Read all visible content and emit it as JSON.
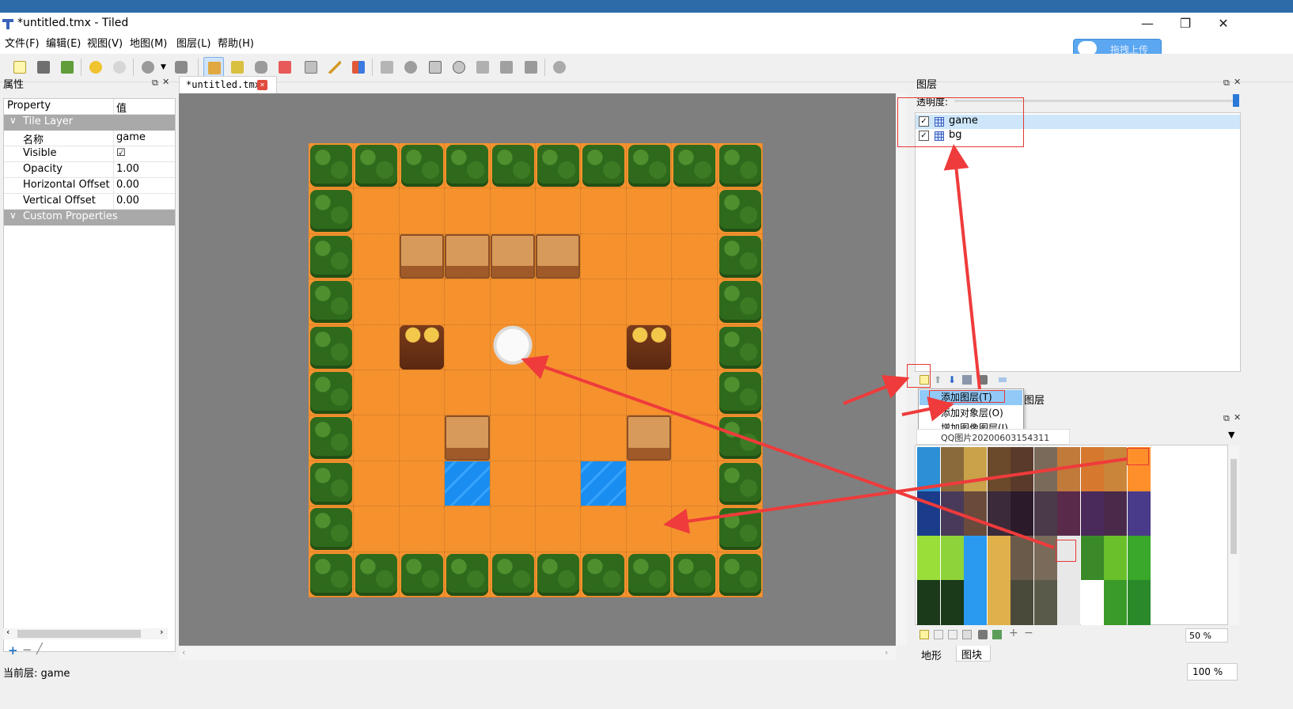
{
  "window": {
    "title": "*untitled.tmx - Tiled",
    "minimize": "—",
    "restore": "❐",
    "close": "✕"
  },
  "upload_button": "拖拽上传",
  "menu": [
    "文件(F)",
    "编辑(E)",
    "视图(V)",
    "地图(M)",
    "图层(L)",
    "帮助(H)"
  ],
  "toolbar_icons": [
    "new-icon",
    "open-icon",
    "save-icon",
    "undo-icon",
    "redo-icon",
    "command-icon",
    "command-dropdown-icon",
    "random-icon",
    "stamp-brush-icon",
    "terrain-brush-icon",
    "bucket-fill-icon",
    "eraser-icon",
    "rect-select-icon",
    "magic-wand-icon",
    "select-same-icon",
    "object-select-icon",
    "edit-polygon-icon",
    "insert-rect-icon",
    "insert-ellipse-icon",
    "insert-polygon-icon",
    "insert-polyline-icon",
    "insert-tile-icon",
    "insert-text-icon"
  ],
  "properties_panel": {
    "title": "属性",
    "header_property": "Property",
    "header_value": "值",
    "group1": "Tile Layer",
    "rows": [
      {
        "key": "名称",
        "value": "game"
      },
      {
        "key": "Visible",
        "value": "☑"
      },
      {
        "key": "Opacity",
        "value": "1.00"
      },
      {
        "key": "Horizontal Offset",
        "value": "0.00"
      },
      {
        "key": "Vertical Offset",
        "value": "0.00"
      }
    ],
    "group2": "Custom Properties"
  },
  "editor": {
    "tab_label": "*untitled.tmx",
    "tab_close": "×"
  },
  "layers_panel": {
    "title": "图层",
    "opacity_label": "透明度:",
    "layers": [
      {
        "name": "game",
        "visible": true
      },
      {
        "name": "bg",
        "visible": true
      }
    ]
  },
  "context_menu": [
    "添加图层(T)",
    "添加对象层(O)",
    "增加图像图层(I)"
  ],
  "partial_tab_text": "图层",
  "tileset_panel": {
    "name": "QQ图片20200603154311",
    "zoom": "50 %",
    "tabs": [
      "地形",
      "图块"
    ]
  },
  "status": {
    "current_layer": "当前层: game",
    "zoom": "100 %"
  },
  "colors": {
    "ground": "#f5922e",
    "canvas_bg": "#7f7f7f",
    "annotation": "#ef3b3b"
  }
}
